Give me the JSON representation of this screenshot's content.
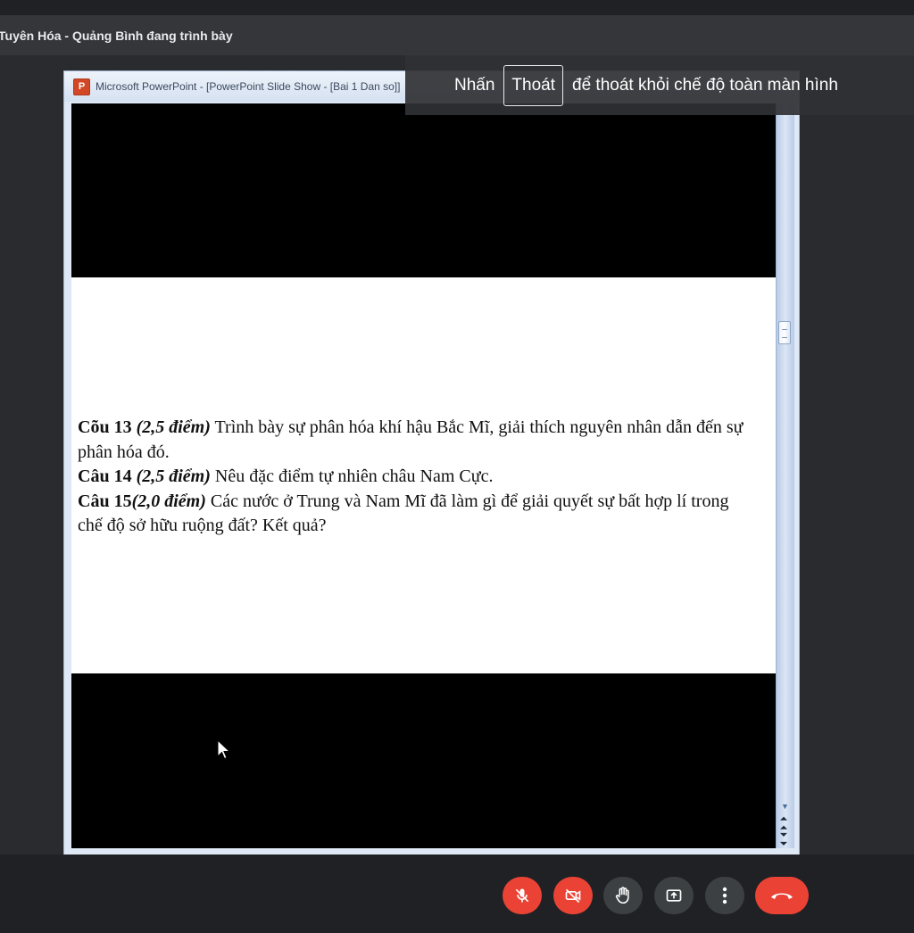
{
  "presenter": {
    "label": "Tuyên Hóa - Quảng Bình đang trình bày"
  },
  "window": {
    "title": "Microsoft PowerPoint - [PowerPoint Slide Show - [Bai 1 Dan so]]"
  },
  "slide": {
    "q13_num": "Cõu 13",
    "q13_pts": "(2,5 điểm)",
    "q13_text": " Trình bày sự phân hóa khí hậu Bắc Mĩ, giải thích nguyên nhân dẫn đến sự phân hóa đó.",
    "q14_num": "Câu 14",
    "q14_pts": "(2,5 điểm)",
    "q14_text": " Nêu đặc điểm tự nhiên châu Nam Cực.",
    "q15_num": "Câu 15",
    "q15_pts": "(2,0 điểm)",
    "q15_text": " Các nước ở Trung và Nam Mĩ đã làm gì để giải quyết sự bất hợp lí trong chế độ sở hữu ruộng đất? Kết quả?"
  },
  "fullscreen_hint": {
    "pre": "Nhấn",
    "key": "Thoát",
    "post": "để thoát khỏi chế độ toàn màn hình"
  },
  "controls": {
    "mic_icon": "mic-off-icon",
    "camera_icon": "camera-off-icon",
    "hand_icon": "raise-hand-icon",
    "present_icon": "present-screen-icon",
    "more_icon": "more-vert-icon",
    "end_icon": "end-call-icon"
  },
  "colors": {
    "danger": "#ea4335",
    "control_gray": "#3c4043",
    "background": "#202124"
  }
}
